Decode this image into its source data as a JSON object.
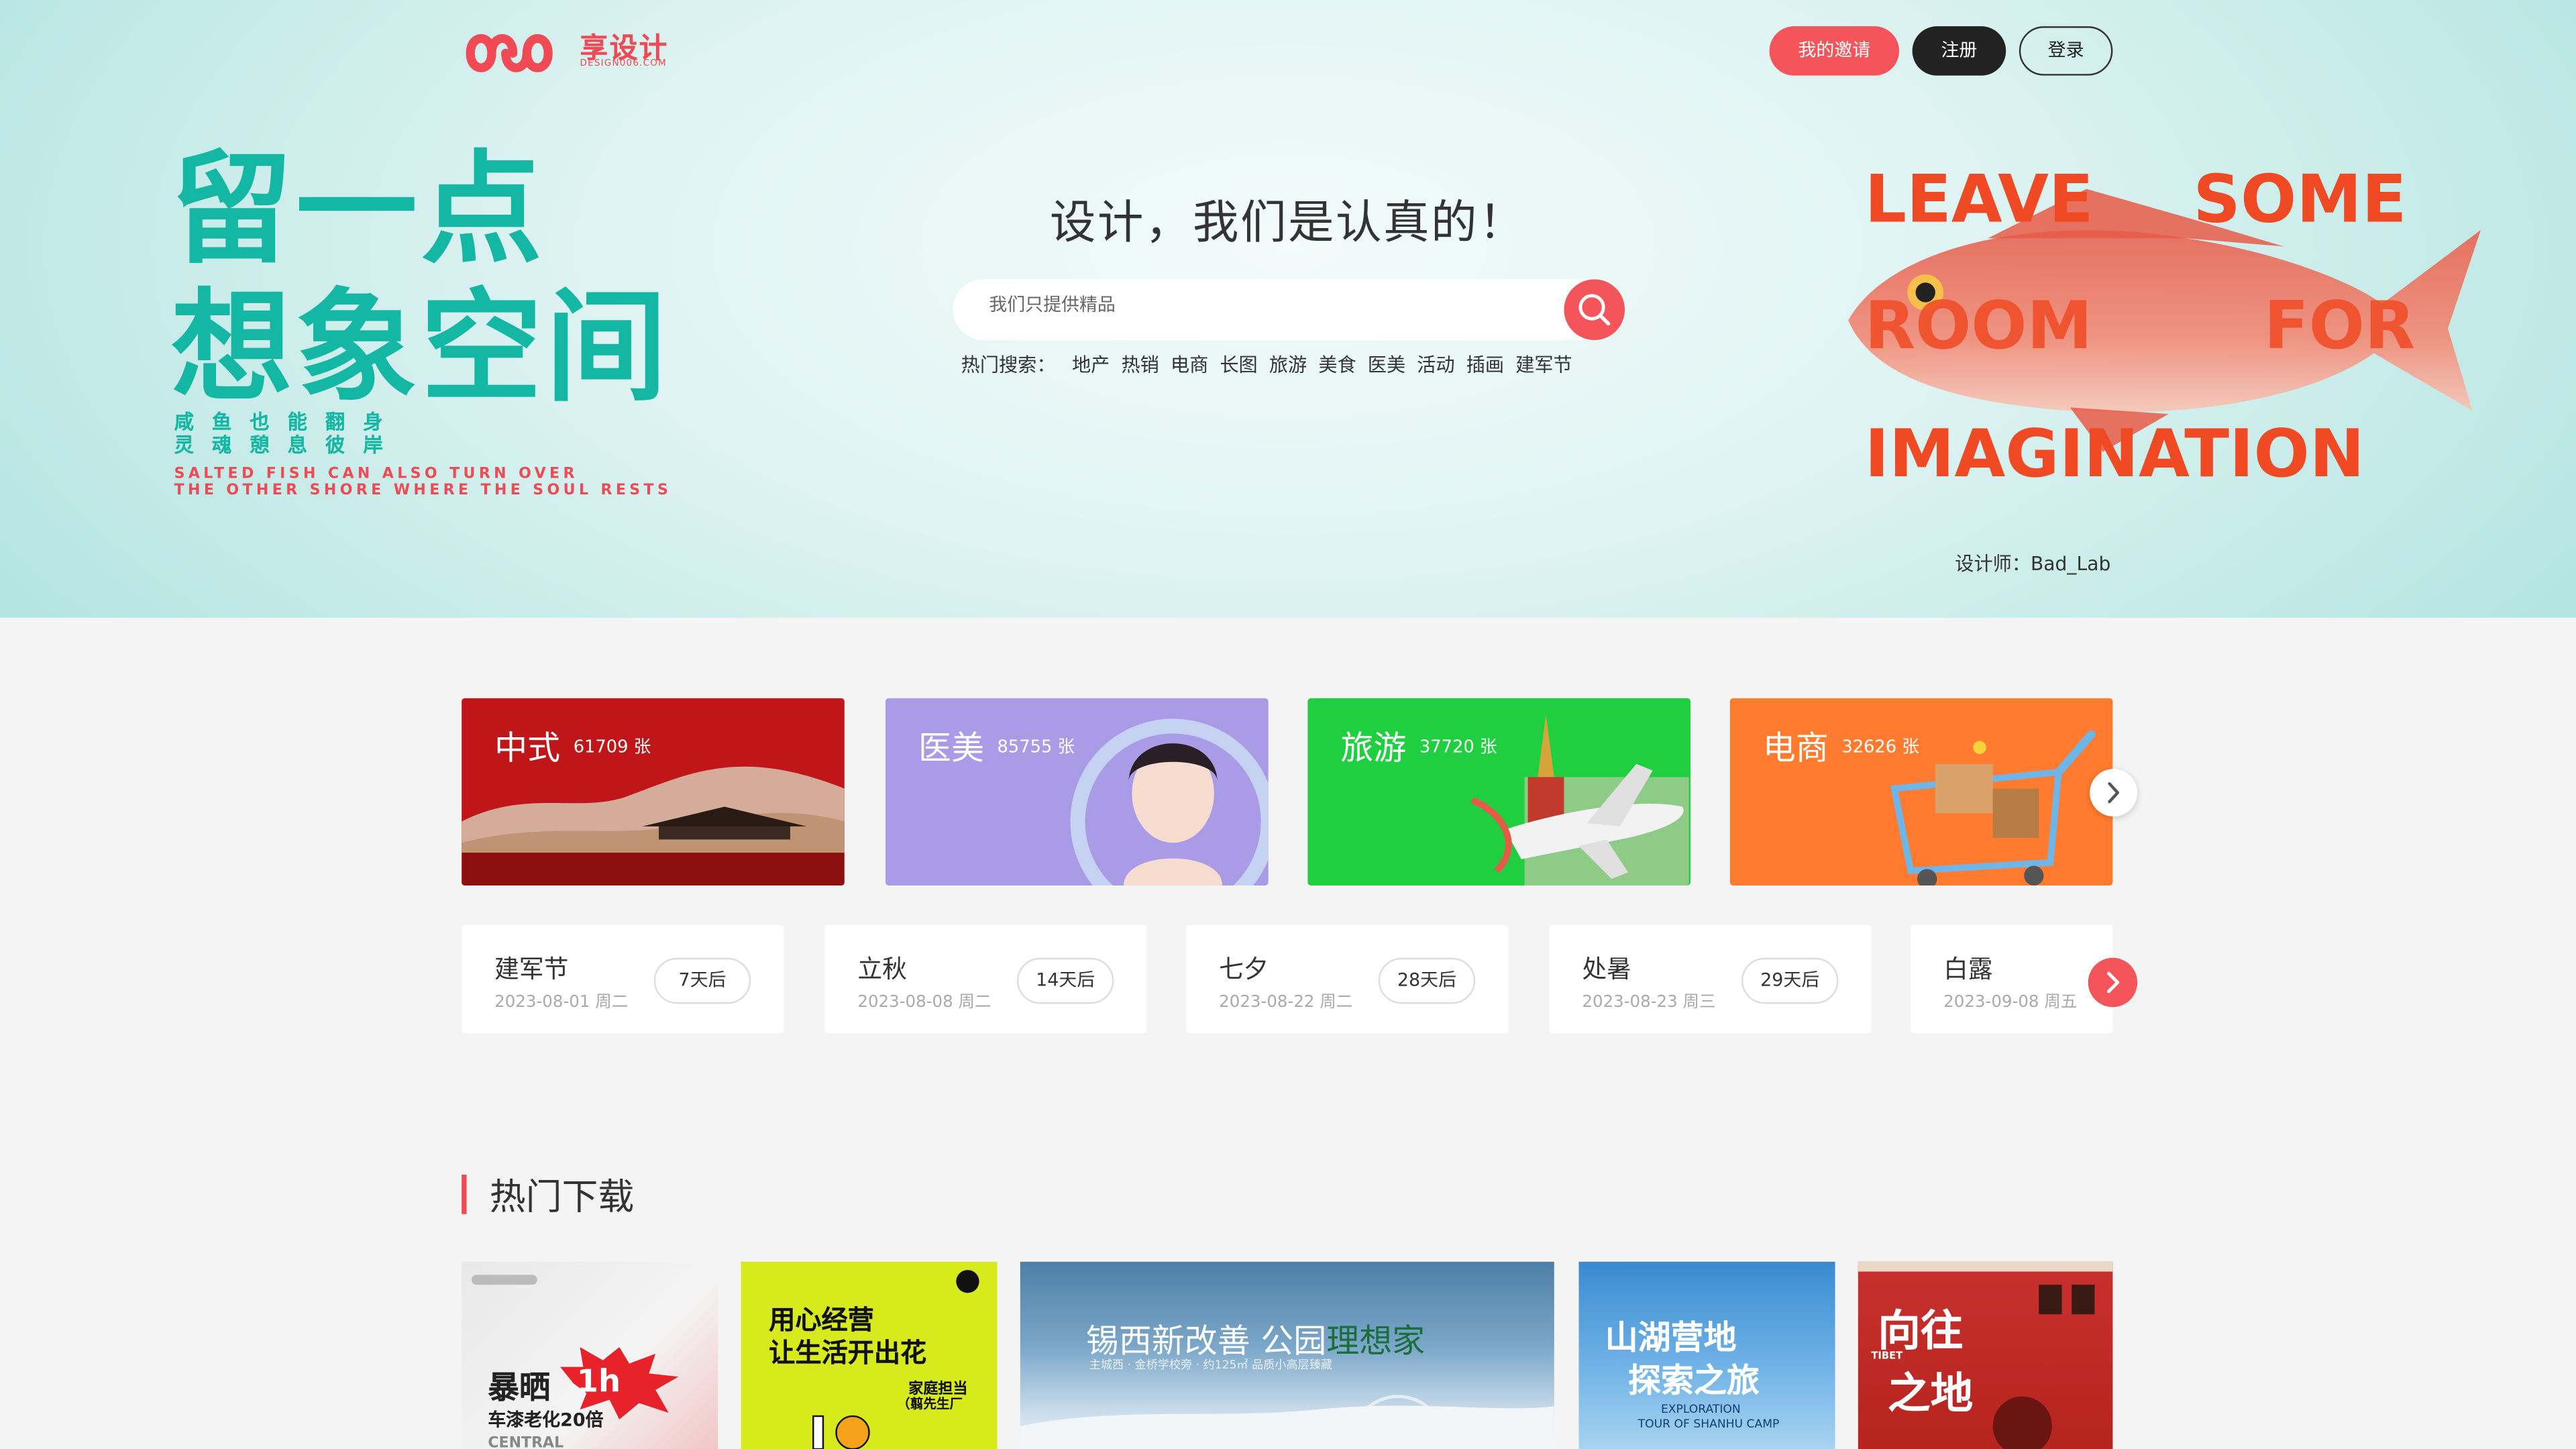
{
  "header": {
    "logo_text": "享设计",
    "logo_sub": "DESIGN006.COM",
    "invite_label": "我的邀请",
    "register_label": "注册",
    "login_label": "登录"
  },
  "hero": {
    "slogan_line1": "留一点",
    "slogan_line2": "想象空间",
    "slogan_small1": "咸鱼也能翻身",
    "slogan_small2": "灵魂憩息彼岸",
    "slogan_en1": "SALTED FISH CAN ALSO TURN OVER",
    "slogan_en2": "THE OTHER SHORE WHERE THE SOUL RESTS",
    "tagline": "设计，我们是认真的！",
    "search_placeholder": "我们只提供精品",
    "hot_label": "热门搜索：",
    "hot_terms": [
      "地产",
      "热销",
      "电商",
      "长图",
      "旅游",
      "美食",
      "医美",
      "活动",
      "插画",
      "建军节"
    ],
    "art_words": [
      "LEAVE",
      "SOME",
      "ROOM",
      "FOR",
      "IMAGINATION"
    ],
    "designer": "设计师：Bad_Lab",
    "colors": {
      "teal": "#14b7a3",
      "red": "#f04a55"
    }
  },
  "categories": [
    {
      "name": "中式",
      "count": "61709 张",
      "color": "#c0161a"
    },
    {
      "name": "医美",
      "count": "85755 张",
      "color": "#a99be6"
    },
    {
      "name": "旅游",
      "count": "37720 张",
      "color": "#1fcf3f"
    },
    {
      "name": "电商",
      "count": "32626 张",
      "color": "#ff7b2f"
    }
  ],
  "holidays": [
    {
      "name": "建军节",
      "date": "2023-08-01 周二",
      "badge": "7天后"
    },
    {
      "name": "立秋",
      "date": "2023-08-08 周二",
      "badge": "14天后"
    },
    {
      "name": "七夕",
      "date": "2023-08-22 周二",
      "badge": "28天后"
    },
    {
      "name": "处暑",
      "date": "2023-08-23 周三",
      "badge": "29天后"
    },
    {
      "name": "白露",
      "date": "2023-09-08 周五",
      "badge": ""
    }
  ],
  "hot_downloads": {
    "title": "热门下载",
    "items": [
      {
        "line1": "暴晒",
        "badge": "1h",
        "line2": "车漆老化20倍",
        "line3": "CENTRAL"
      },
      {
        "line1": "用心经营",
        "line2": "让生活开出花",
        "line3": "家庭担当",
        "line4": "（翦先生厂"
      },
      {
        "line1": "锡西新改善 公园",
        "highlight": "理想家",
        "line2": "主城西 · 金桥学校旁 · 约125㎡ 品质小高层臻藏"
      },
      {
        "line1": "山湖营地",
        "line2": "探索之旅",
        "line3": "EXPLORATION",
        "line4": "TOUR OF SHANHU CAMP"
      },
      {
        "line1": "向往",
        "line2": "之地",
        "tag": "TIBET"
      }
    ]
  }
}
